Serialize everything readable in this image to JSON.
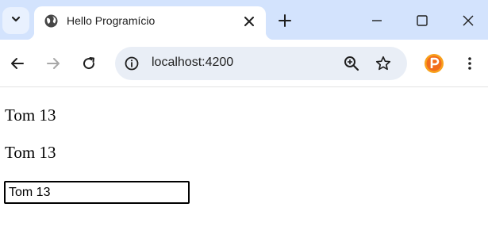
{
  "browser": {
    "tab": {
      "title": "Hello Programício"
    },
    "address_bar": {
      "url": "localhost:4200"
    },
    "colors": {
      "tabstrip": "#d3e3fd",
      "omnibox": "#e9eef6",
      "extension": "#f26c1c"
    },
    "icons": [
      "tab-search-icon",
      "globe-icon",
      "close-icon",
      "plus-icon",
      "minimize-icon",
      "maximize-icon",
      "window-close-icon",
      "back-arrow-icon",
      "forward-arrow-icon",
      "reload-icon",
      "site-info-icon",
      "zoom-icon",
      "star-icon",
      "extension-icon",
      "kebab-menu-icon"
    ]
  },
  "page": {
    "line1": "Tom 13",
    "line2": "Tom 13",
    "input_value": "Tom 13"
  }
}
